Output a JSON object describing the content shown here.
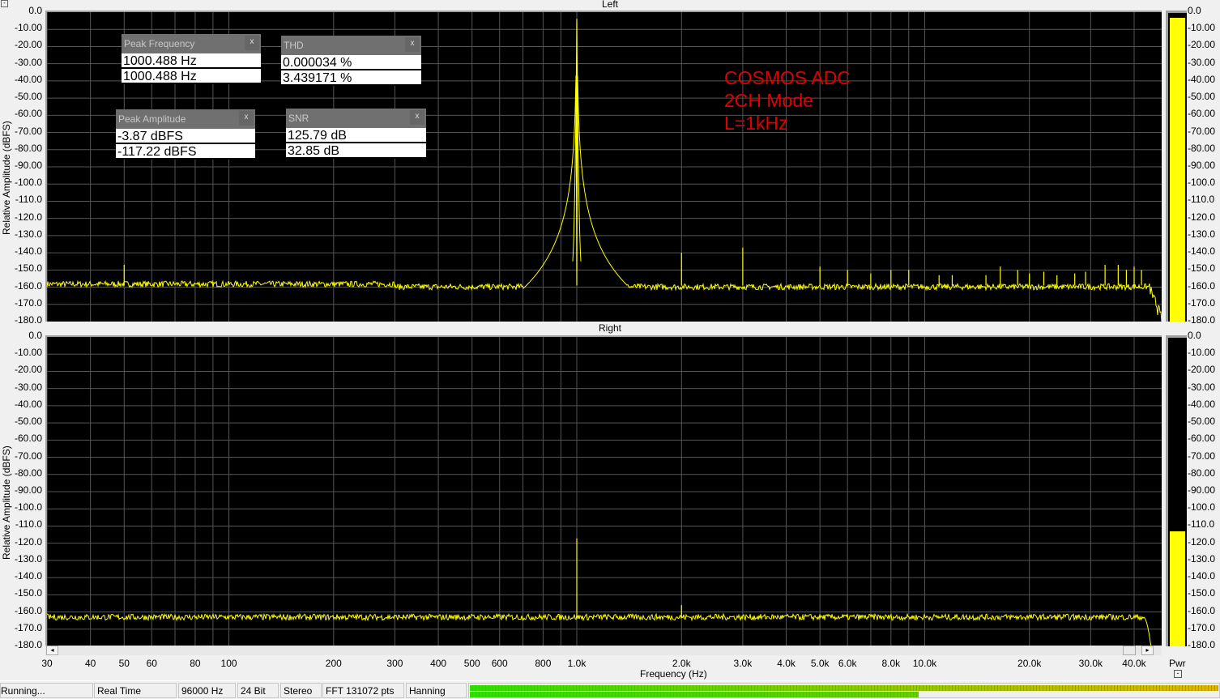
{
  "channels": {
    "left_title": "Left",
    "right_title": "Right"
  },
  "y_axis": {
    "title": "Relative Amplitude (dBFS)",
    "ticks": [
      "0.0",
      "-10.00",
      "-20.00",
      "-30.00",
      "-40.00",
      "-50.00",
      "-60.00",
      "-70.00",
      "-80.00",
      "-90.00",
      "-100.0",
      "-110.0",
      "-120.0",
      "-130.0",
      "-140.0",
      "-150.0",
      "-160.0",
      "-170.0",
      "-180.0"
    ],
    "range": [
      -180,
      0
    ]
  },
  "x_axis": {
    "title": "Frequency (Hz)",
    "range": [
      30,
      48000
    ],
    "labeled_ticks": [
      {
        "f": 30,
        "label": "30"
      },
      {
        "f": 40,
        "label": "40"
      },
      {
        "f": 50,
        "label": "50"
      },
      {
        "f": 60,
        "label": "60"
      },
      {
        "f": 80,
        "label": "80"
      },
      {
        "f": 100,
        "label": "100"
      },
      {
        "f": 200,
        "label": "200"
      },
      {
        "f": 300,
        "label": "300"
      },
      {
        "f": 400,
        "label": "400"
      },
      {
        "f": 500,
        "label": "500"
      },
      {
        "f": 600,
        "label": "600"
      },
      {
        "f": 800,
        "label": "800"
      },
      {
        "f": 1000,
        "label": "1.0k"
      },
      {
        "f": 2000,
        "label": "2.0k"
      },
      {
        "f": 3000,
        "label": "3.0k"
      },
      {
        "f": 4000,
        "label": "4.0k"
      },
      {
        "f": 5000,
        "label": "5.0k"
      },
      {
        "f": 6000,
        "label": "6.0k"
      },
      {
        "f": 8000,
        "label": "8.0k"
      },
      {
        "f": 10000,
        "label": "10.0k"
      },
      {
        "f": 20000,
        "label": "20.0k"
      },
      {
        "f": 30000,
        "label": "30.0k"
      },
      {
        "f": 40000,
        "label": "40.0k"
      }
    ],
    "grid": [
      30,
      40,
      50,
      60,
      70,
      80,
      90,
      100,
      200,
      300,
      400,
      500,
      600,
      700,
      800,
      900,
      1000,
      2000,
      3000,
      4000,
      5000,
      6000,
      7000,
      8000,
      9000,
      10000,
      20000,
      30000,
      40000
    ]
  },
  "meters": {
    "label": "Pwr",
    "left_level_db": -3,
    "right_level_db": -113
  },
  "readouts": {
    "peak_frequency": {
      "title": "Peak Frequency",
      "left": "1000.488 Hz",
      "right": "1000.488 Hz"
    },
    "thd": {
      "title": "THD",
      "left": "0.000034 %",
      "right": "3.439171 %"
    },
    "peak_amplitude": {
      "title": "Peak Amplitude",
      "left": "-3.87 dBFS",
      "right": "-117.22 dBFS"
    },
    "snr": {
      "title": "SNR",
      "left": "125.79 dB",
      "right": "32.85 dB"
    },
    "close": "x"
  },
  "annotation": [
    "COSMOS ADC",
    "2CH Mode",
    "L=1kHz"
  ],
  "status": {
    "state": "Running...",
    "mode": "Real Time",
    "rate": "96000 Hz",
    "bits": "24 Bit",
    "channels": "Stereo",
    "fft": "FFT 131072 pts",
    "window": "Hanning",
    "cpu_meter_top": 1.0,
    "cpu_meter_bottom": 0.6
  },
  "spectrum": {
    "color": "#ffff00",
    "left": {
      "floor_db": -159,
      "fundamental": {
        "f": 1000,
        "db": -3.87
      },
      "spurs": [
        [
          50,
          -147
        ],
        [
          2000,
          -140
        ],
        [
          3000,
          -137
        ],
        [
          5000,
          -148
        ],
        [
          6000,
          -150
        ],
        [
          7000,
          -152
        ],
        [
          8000,
          -150
        ],
        [
          9000,
          -150
        ],
        [
          11000,
          -153
        ],
        [
          12000,
          -153
        ],
        [
          15000,
          -153
        ],
        [
          16500,
          -148
        ],
        [
          18500,
          -150
        ],
        [
          20000,
          -152
        ],
        [
          22000,
          -151
        ],
        [
          24000,
          -153
        ],
        [
          27000,
          -152
        ],
        [
          29000,
          -151
        ],
        [
          33000,
          -147
        ],
        [
          36000,
          -147
        ],
        [
          38000,
          -150
        ],
        [
          40000,
          -148
        ],
        [
          42000,
          -150
        ]
      ]
    },
    "right": {
      "floor_db": -163,
      "fundamental": {
        "f": 1000,
        "db": -117.22
      },
      "spurs": [
        [
          2000,
          -156
        ]
      ],
      "rolloff_hz": 42500
    }
  }
}
